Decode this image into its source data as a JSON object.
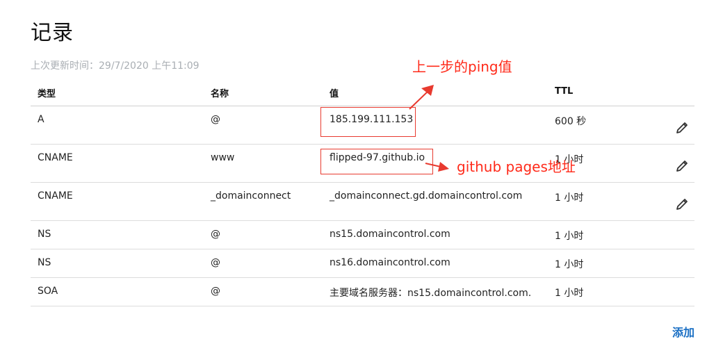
{
  "page": {
    "title": "记录",
    "last_updated": "上次更新时间：29/7/2020 上午11:09",
    "add_label": "添加"
  },
  "table": {
    "headers": {
      "type": "类型",
      "name": "名称",
      "value": "值",
      "ttl": "TTL"
    },
    "rows": [
      {
        "type": "A",
        "name": "@",
        "value": "185.199.111.153",
        "ttl": "600 秒",
        "editable": true
      },
      {
        "type": "CNAME",
        "name": "www",
        "value": "flipped-97.github.io",
        "ttl": "1 小时",
        "editable": true
      },
      {
        "type": "CNAME",
        "name": "_domainconnect",
        "value": "_domainconnect.gd.domaincontrol.com",
        "ttl": "1 小时",
        "editable": true
      },
      {
        "type": "NS",
        "name": "@",
        "value": "ns15.domaincontrol.com",
        "ttl": "1 小时",
        "editable": false
      },
      {
        "type": "NS",
        "name": "@",
        "value": "ns16.domaincontrol.com",
        "ttl": "1 小时",
        "editable": false
      },
      {
        "type": "SOA",
        "name": "@",
        "value": "主要域名服务器：ns15.domaincontrol.com.",
        "ttl": "1 小时",
        "editable": false
      }
    ]
  },
  "annotations": {
    "ping_note": "上一步的ping值",
    "pages_note": "github pages地址",
    "color": "#ff2a1a"
  },
  "icons": {
    "edit": "pencil-icon"
  },
  "colors": {
    "link": "#1a6fc4",
    "muted": "#a9aeb3",
    "annotation": "#e83a2f"
  }
}
